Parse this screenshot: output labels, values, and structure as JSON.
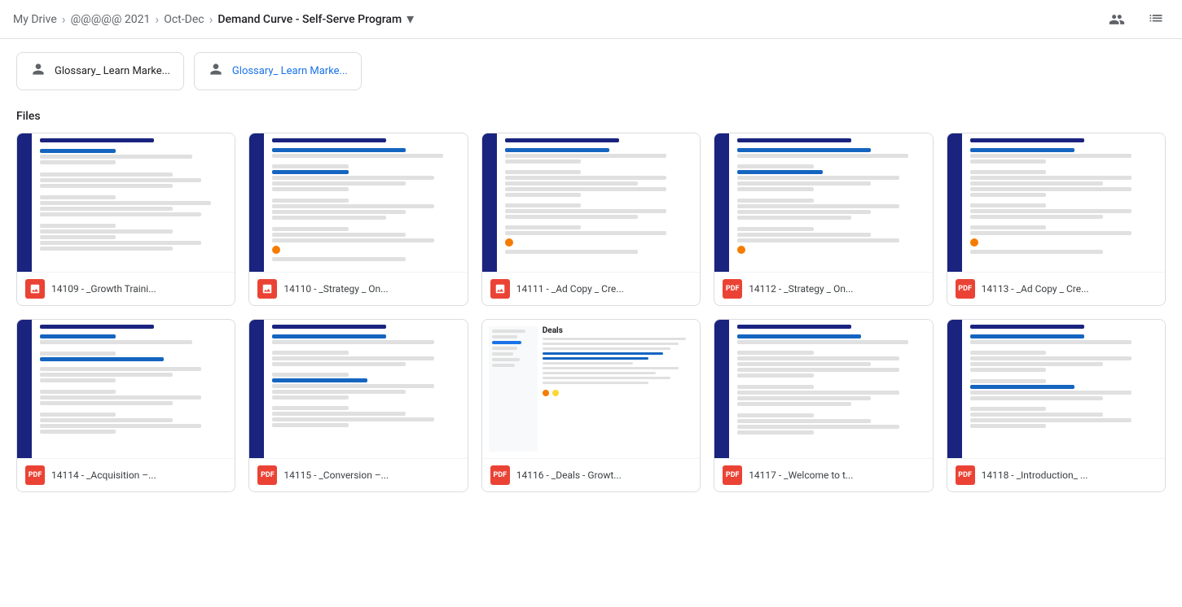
{
  "breadcrumb": {
    "items": [
      {
        "label": "My Drive",
        "active": false
      },
      {
        "label": "@@@@@  2021",
        "active": false
      },
      {
        "label": "Oct-Dec",
        "active": false
      },
      {
        "label": "Demand Curve - Self-Serve Program",
        "active": true
      }
    ]
  },
  "shortcuts": [
    {
      "label": "Glossary_ Learn Marke...",
      "linked": false
    },
    {
      "label": "Glossary_ Learn Marke...",
      "linked": true
    }
  ],
  "section": {
    "label": "Files"
  },
  "files": [
    {
      "id": "14109",
      "name": "14109 - _Growth Traini...",
      "type": "image"
    },
    {
      "id": "14110",
      "name": "14110 - _Strategy _ On...",
      "type": "image"
    },
    {
      "id": "14111",
      "name": "14111 - _Ad Copy _ Cre...",
      "type": "image"
    },
    {
      "id": "14112",
      "name": "14112 - _Strategy _ On...",
      "type": "pdf"
    },
    {
      "id": "14113",
      "name": "14113 - _Ad Copy _ Cre...",
      "type": "pdf"
    },
    {
      "id": "14114",
      "name": "14114 - _Acquisition –...",
      "type": "pdf"
    },
    {
      "id": "14115",
      "name": "14115 - _Conversion –...",
      "type": "pdf"
    },
    {
      "id": "14116",
      "name": "14116 - _Deals - Growt...",
      "type": "pdf"
    },
    {
      "id": "14117",
      "name": "14117 - _Welcome to t...",
      "type": "pdf"
    },
    {
      "id": "14118",
      "name": "14118 - _Introduction_ ...",
      "type": "pdf"
    }
  ],
  "icons": {
    "person": "👤",
    "chevron_right": "›",
    "dropdown": "▾",
    "people": "👥",
    "grid": "⊞"
  }
}
